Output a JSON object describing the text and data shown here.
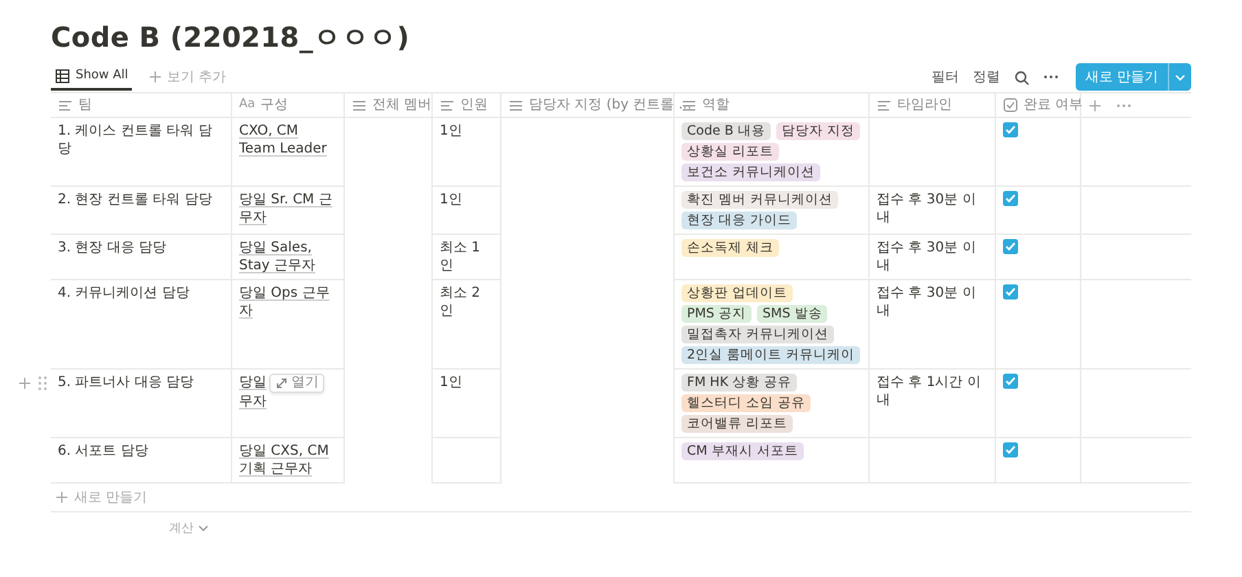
{
  "title": "Code B (220218_ㅇㅇㅇ)",
  "views": [
    {
      "label": "Show All",
      "selected": true
    }
  ],
  "add_view": "보기 추가",
  "toolbar": {
    "filter": "필터",
    "sort": "정렬",
    "new_button": "새로 만들기"
  },
  "columns": [
    {
      "kind": "text",
      "label": "팀"
    },
    {
      "kind": "title",
      "label": "구성",
      "icon": "Aa"
    },
    {
      "kind": "multi",
      "label": "전체 멤버"
    },
    {
      "kind": "text",
      "label": "인원"
    },
    {
      "kind": "multi",
      "label": "담당자 지정 (by 컨트롤 ..."
    },
    {
      "kind": "multi",
      "label": "역할"
    },
    {
      "kind": "text",
      "label": "타임라인"
    },
    {
      "kind": "checkbox",
      "label": "완료 여부"
    }
  ],
  "rows": [
    {
      "team": "1. 케이스 컨트롤 타워 담당",
      "composition": "CXO, CM Team Leader",
      "count": "1인",
      "roles": [
        {
          "label": "Code B 내용",
          "color": "#e3e2e0"
        },
        {
          "label": "담당자 지정",
          "color": "#f5e0e9"
        },
        {
          "label": "상황실 리포트",
          "color": "#f5e0e9"
        },
        {
          "label": "보건소 커뮤니케이션",
          "color": "#e8deee"
        }
      ],
      "done": true
    },
    {
      "team": "2. 현장 컨트롤 타워 담당",
      "composition": "당일 Sr. CM 근무자",
      "count": "1인",
      "roles": [
        {
          "label": "확진 멤버 커뮤니케이션",
          "color": "#eeeae6"
        },
        {
          "label": "현장 대응 가이드",
          "color": "#d3e5ef"
        }
      ],
      "timeline": "접수 후 30분 이내",
      "done": true
    },
    {
      "team": "3. 현장 대응 담당",
      "composition": "당일 Sales, Stay 근무자",
      "count": "최소 1인",
      "roles": [
        {
          "label": "손소독제 체크",
          "color": "#fdecc8"
        }
      ],
      "timeline": "접수 후 30분 이내",
      "done": true
    },
    {
      "team": "4. 커뮤니케이션 담당",
      "composition": "당일 Ops 근무자",
      "count": "최소 2인",
      "roles": [
        {
          "label": "상황판 업데이트",
          "color": "#fdecc8"
        },
        {
          "label": "PMS 공지",
          "color": "#dbeddb"
        },
        {
          "label": "SMS 발송",
          "color": "#dbeddb"
        },
        {
          "label": "밀접촉자 커뮤니케이션",
          "color": "#e3e2e0"
        },
        {
          "label": "2인실 룸메이트 커뮤니케이",
          "color": "#d3e5ef"
        }
      ],
      "timeline": "접수 후 30분 이내",
      "done": true
    },
    {
      "team": "5. 파트너사 대응 담당",
      "composition": "당일",
      "open_button": "열기",
      "composition_more": "무자",
      "count": "1인",
      "roles": [
        {
          "label": "FM HK 상황 공유",
          "color": "#e3e2e0"
        },
        {
          "label": "헬스터디 소임 공유",
          "color": "#fadec9"
        },
        {
          "label": "코어밸류 리포트",
          "color": "#eee0da"
        }
      ],
      "timeline": "접수 후 1시간 이내",
      "done": true
    },
    {
      "team": "6. 서포트 담당",
      "composition": "당일 CXS, CM 기획 근무자",
      "roles": [
        {
          "label": "CM 부재시 서포트",
          "color": "#e8deee"
        }
      ],
      "done": true
    }
  ],
  "footer": {
    "new_row": "새로 만들기",
    "calculate": "계산"
  }
}
